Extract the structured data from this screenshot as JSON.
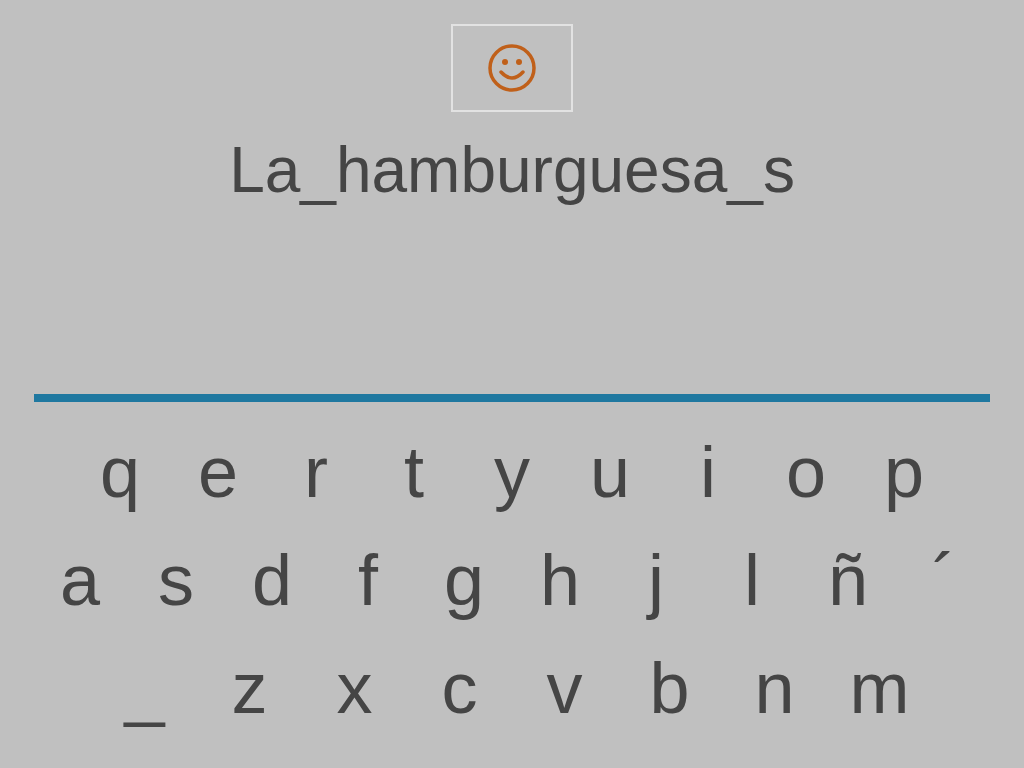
{
  "answer": "La_hamburguesa_s",
  "keyboard": {
    "rows": [
      [
        "q",
        "e",
        "r",
        "t",
        "y",
        "u",
        "i",
        "o",
        "p"
      ],
      [
        "a",
        "s",
        "d",
        "f",
        "g",
        "h",
        "j",
        "l",
        "ñ",
        "´"
      ],
      [
        "_",
        "z",
        "x",
        "c",
        "v",
        "b",
        "n",
        "m"
      ]
    ]
  }
}
